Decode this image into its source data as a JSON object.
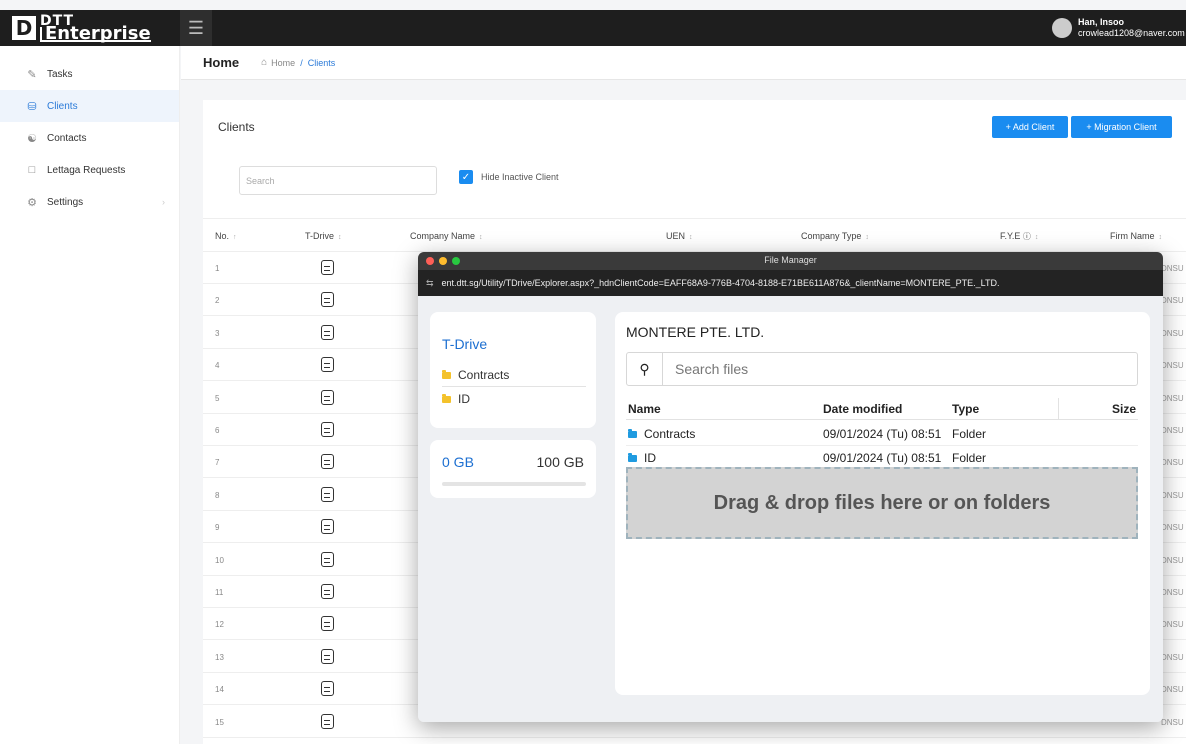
{
  "app": {
    "logo_letter": "D",
    "logo_line1": "DTT",
    "logo_line2": "Enterprise",
    "menu_icon": "hamburger-icon"
  },
  "user": {
    "name": "Han, Insoo",
    "email": "crowlead1208@naver.com"
  },
  "sidebar": {
    "items": [
      {
        "label": "Tasks",
        "icon": "checklist-icon",
        "active": false
      },
      {
        "label": "Clients",
        "icon": "database-icon",
        "active": true
      },
      {
        "label": "Contacts",
        "icon": "contacts-icon",
        "active": false
      },
      {
        "label": "Lettaga Requests",
        "icon": "document-icon",
        "active": false
      },
      {
        "label": "Settings",
        "icon": "gear-icon",
        "active": false
      }
    ]
  },
  "header": {
    "title": "Home",
    "breadcrumb": {
      "home": "Home",
      "separator": "/",
      "current": "Clients"
    }
  },
  "clients": {
    "title": "Clients",
    "add_button": "+ Add Client",
    "migration_button": "+ Migration Client",
    "search_placeholder": "Search",
    "hide_inactive_label": "Hide Inactive Client",
    "hide_inactive_checked": true,
    "columns": [
      "No.",
      "T-Drive",
      "Company Name",
      "UEN",
      "Company Type",
      "F.Y.E",
      "Firm Name"
    ],
    "sort_asc_indicator": "↑",
    "sort_indicator": "↕",
    "row_numbers": [
      "1",
      "2",
      "3",
      "4",
      "5",
      "6",
      "7",
      "8",
      "9",
      "10",
      "11",
      "12",
      "13",
      "14",
      "15"
    ],
    "row_tail_text": "DNSU"
  },
  "file_manager": {
    "window_title": "File Manager",
    "url": "ent.dtt.sg/Utility/TDrive/Explorer.aspx?_hdnClientCode=EAFF68A9-776B-4704-8188-E71BE611A876&_clientName=MONTERE_PTE._LTD.",
    "tree_title": "T-Drive",
    "tree_items": [
      "Contracts",
      "ID"
    ],
    "storage_used": "0 GB",
    "storage_total": "100 GB",
    "storage_used_fraction": 0,
    "client_name": "MONTERE PTE. LTD.",
    "search_placeholder": "Search files",
    "headers": {
      "name": "Name",
      "date": "Date modified",
      "type": "Type",
      "size": "Size"
    },
    "files": [
      {
        "name": "Contracts",
        "date": "09/01/2024 (Tu) 08:51",
        "type": "Folder"
      },
      {
        "name": "ID",
        "date": "09/01/2024 (Tu) 08:51",
        "type": "Folder"
      }
    ],
    "dropzone_text": "Drag & drop files here or on folders"
  },
  "colors": {
    "accent": "#1a8cf0",
    "topbar": "#1e1e1e",
    "folder_yellow": "#f4c22b",
    "folder_blue": "#1f9be0"
  }
}
